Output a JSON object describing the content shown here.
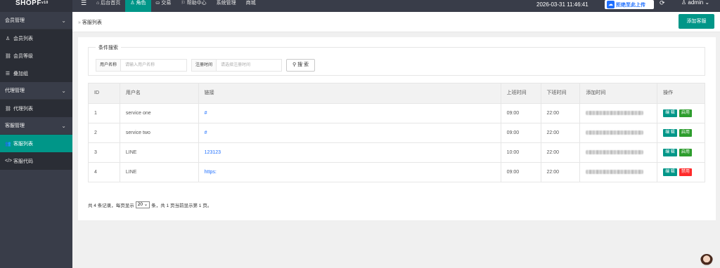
{
  "app": {
    "logo": "SHOPF",
    "version": "v10"
  },
  "topnav": {
    "items": [
      {
        "icon": "home-icon",
        "glyph": "⌂",
        "label": "后台首页",
        "active": false
      },
      {
        "icon": "user-icon",
        "glyph": "♙",
        "label": "角色",
        "active": true
      },
      {
        "icon": "trade-icon",
        "glyph": "⛀",
        "label": "交易",
        "active": false
      },
      {
        "icon": "flag-icon",
        "glyph": "⚐",
        "label": "帮助中心",
        "active": false
      },
      {
        "icon": "",
        "glyph": "",
        "label": "系统管理",
        "active": false
      },
      {
        "icon": "",
        "glyph": "",
        "label": "商城",
        "active": false
      }
    ],
    "datetime": "2026-03-31 11:46:41",
    "upload_label": "拒绝至此上传",
    "user_name": "admin"
  },
  "sidebar": {
    "groups": [
      {
        "label": "会员管理",
        "items": [
          {
            "icon": "user-icon",
            "glyph": "♙",
            "label": "会员列表",
            "active": false
          },
          {
            "icon": "link-icon",
            "glyph": "⛓",
            "label": "会员等级",
            "active": false
          },
          {
            "icon": "list-icon",
            "glyph": "☰",
            "label": "叠加组",
            "active": false
          }
        ]
      },
      {
        "label": "代理管理",
        "items": [
          {
            "icon": "link-icon",
            "glyph": "⛓",
            "label": "代理列表",
            "active": false
          }
        ]
      },
      {
        "label": "客服管理",
        "items": [
          {
            "icon": "users-icon",
            "glyph": "👥",
            "label": "客服列表",
            "active": true
          },
          {
            "icon": "code-icon",
            "glyph": "</>",
            "label": "客服代码",
            "active": false
          }
        ]
      }
    ]
  },
  "breadcrumb": {
    "sep": "»",
    "label": "客服列表"
  },
  "add_button": "添加客服",
  "search": {
    "legend": "条件搜索",
    "username_label": "用户名称",
    "username_placeholder": "请输入用户名称",
    "regtime_label": "注册时间",
    "regtime_placeholder": "请选择注册时间",
    "search_button": "搜 索"
  },
  "table": {
    "headers": [
      "ID",
      "用户名",
      "链接",
      "上班时间",
      "下班时间",
      "添加时间",
      "操作"
    ],
    "rows": [
      {
        "id": "1",
        "username": "service one",
        "link": "#",
        "start": "09:00",
        "end": "22:00",
        "edit": "编 辑",
        "toggle": "启用",
        "toggle_type": "on"
      },
      {
        "id": "2",
        "username": "service two",
        "link": "#",
        "start": "09:00",
        "end": "22:00",
        "edit": "编 辑",
        "toggle": "启用",
        "toggle_type": "on"
      },
      {
        "id": "3",
        "username": "LINE",
        "link": "123123",
        "start": "10:00",
        "end": "22:00",
        "edit": "编 辑",
        "toggle": "启用",
        "toggle_type": "on"
      },
      {
        "id": "4",
        "username": "LINE",
        "link": "https:",
        "start": "09:00",
        "end": "22:00",
        "edit": "编 辑",
        "toggle": "禁用",
        "toggle_type": "off"
      }
    ]
  },
  "pager": {
    "prefix": "共 4 条记录，每页显示",
    "per_page": "20",
    "suffix": "条，共 1 页当前显示第 1 页。"
  },
  "colors": {
    "accent": "#009688",
    "topbar": "#393d49",
    "link": "#1e6fff",
    "danger": "#ff2a2a",
    "success": "#2e9d2e"
  }
}
